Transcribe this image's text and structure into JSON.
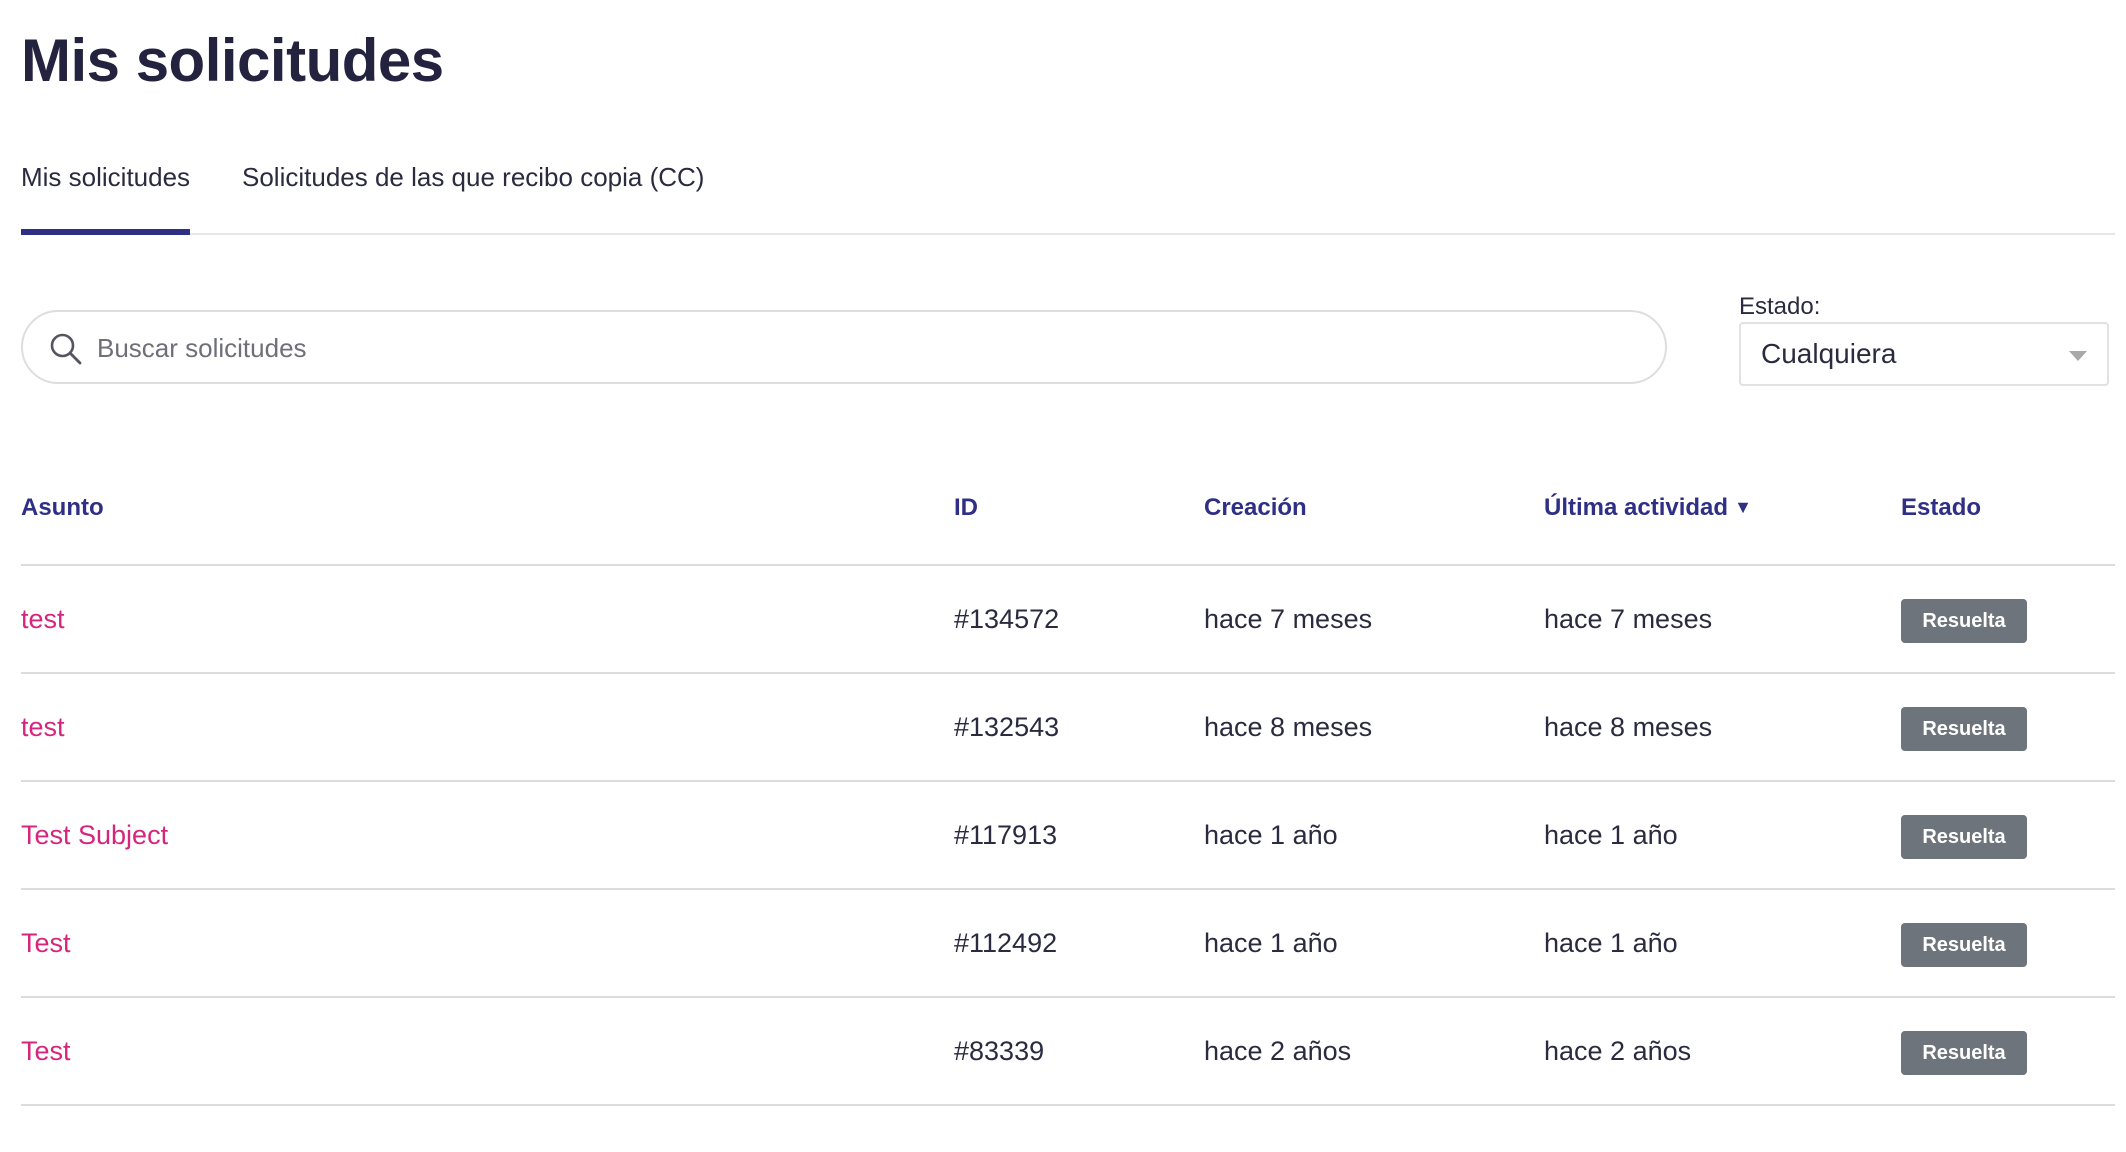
{
  "page": {
    "title": "Mis solicitudes"
  },
  "tabs": [
    {
      "label": "Mis solicitudes",
      "active": true
    },
    {
      "label": "Solicitudes de las que recibo copia (CC)",
      "active": false
    }
  ],
  "search": {
    "placeholder": "Buscar solicitudes",
    "icon": "search-icon"
  },
  "filter": {
    "label": "Estado:",
    "selected": "Cualquiera",
    "icon": "chevron-down-icon"
  },
  "table": {
    "headers": {
      "subject": "Asunto",
      "id": "ID",
      "created": "Creación",
      "last_activity": "Última actividad",
      "status": "Estado"
    },
    "sort_indicator": "▼",
    "rows": [
      {
        "subject": "test",
        "id": "#134572",
        "created": "hace 7 meses",
        "last_activity": "hace 7 meses",
        "status": "Resuelta"
      },
      {
        "subject": "test",
        "id": "#132543",
        "created": "hace 8 meses",
        "last_activity": "hace 8 meses",
        "status": "Resuelta"
      },
      {
        "subject": "Test Subject",
        "id": "#117913",
        "created": "hace 1 año",
        "last_activity": "hace 1 año",
        "status": "Resuelta"
      },
      {
        "subject": "Test",
        "id": "#112492",
        "created": "hace 1 año",
        "last_activity": "hace 1 año",
        "status": "Resuelta"
      },
      {
        "subject": "Test",
        "id": "#83339",
        "created": "hace 2 años",
        "last_activity": "hace 2 años",
        "status": "Resuelta"
      }
    ]
  },
  "colors": {
    "title": "#23233f",
    "accent": "#2f2f86",
    "link": "#d6257c",
    "badge_bg": "#6d747b",
    "badge_text": "#ffffff"
  }
}
